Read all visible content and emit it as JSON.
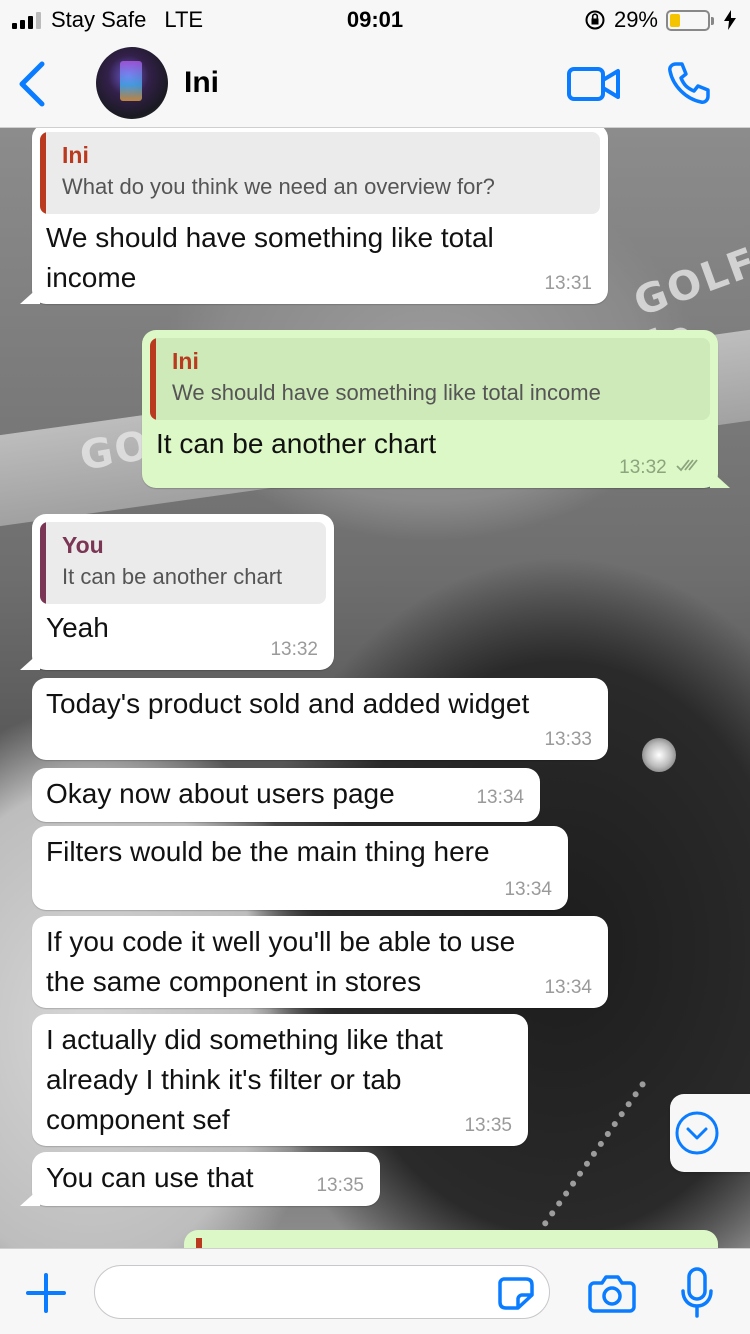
{
  "status_bar": {
    "carrier": "Stay Safe",
    "network": "LTE",
    "time": "09:01",
    "battery_percent": "29%",
    "battery_level": 0.29,
    "icons": [
      "signal-icon",
      "orientation-lock-icon",
      "battery-icon",
      "charging-bolt-icon"
    ]
  },
  "header": {
    "contact_name": "Ini",
    "icons": [
      "chevron-left-icon",
      "video-camera-icon",
      "phone-icon"
    ]
  },
  "theme": {
    "accent": "#0a7cff",
    "outgoing_bubble": "#dcf8c6",
    "incoming_bubble": "#ffffff",
    "quote_author_ini": "#b93a1e",
    "quote_author_you": "#7a3654",
    "timestamp": "#9a9a9a"
  },
  "messages": [
    {
      "direction": "in",
      "quote": {
        "author": "Ini",
        "text": "What do you think we need an overview for?"
      },
      "lines": [
        "We should have something like total",
        "income"
      ],
      "time": "13:31"
    },
    {
      "direction": "out",
      "quote": {
        "author": "Ini",
        "text": "We should have something like total income"
      },
      "lines": [
        "It can be another chart"
      ],
      "time": "13:32",
      "status": "read-ticks"
    },
    {
      "direction": "in",
      "quote": {
        "author": "You",
        "text": "It can be another chart"
      },
      "lines": [
        "Yeah"
      ],
      "time": "13:32"
    },
    {
      "direction": "in",
      "lines": [
        "Today's product sold and added widget"
      ],
      "time": "13:33"
    },
    {
      "direction": "in",
      "lines": [
        "Okay now about users page"
      ],
      "time": "13:34"
    },
    {
      "direction": "in",
      "lines": [
        "Filters would be the main thing here"
      ],
      "time": "13:34"
    },
    {
      "direction": "in",
      "lines": [
        "If you code it well you'll be able to use",
        "the same component in stores"
      ],
      "time": "13:34"
    },
    {
      "direction": "in",
      "lines": [
        "I actually did something like that",
        "already I think it's filter or tab",
        "component sef"
      ],
      "time": "13:35"
    },
    {
      "direction": "in",
      "lines": [
        "You can use that"
      ],
      "time": "13:35"
    }
  ],
  "wallpaper_text": [
    "GOLF le",
    "GO"
  ],
  "composer": {
    "input_value": "",
    "input_placeholder": "",
    "icons": [
      "plus-icon",
      "sticker-icon",
      "camera-icon",
      "microphone-icon",
      "chevron-down-circle-icon"
    ]
  }
}
